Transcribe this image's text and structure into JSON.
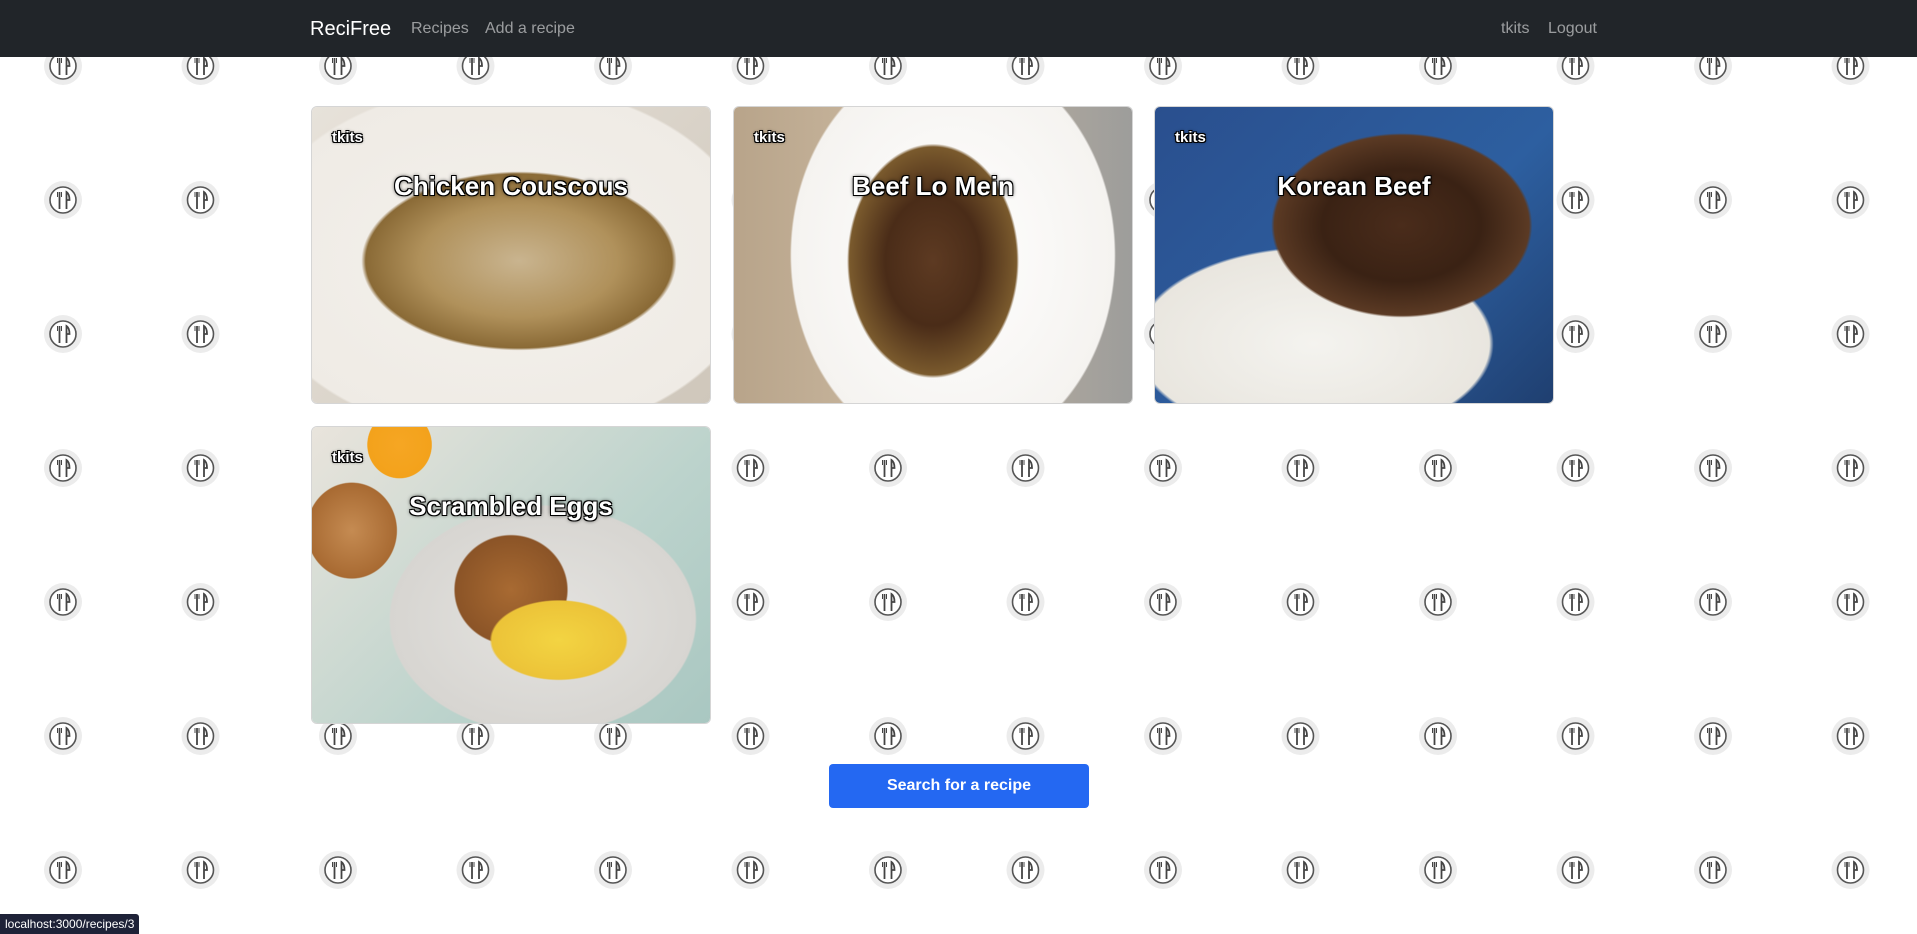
{
  "navbar": {
    "brand": "ReciFree",
    "links": [
      {
        "label": "Recipes"
      },
      {
        "label": "Add a recipe"
      }
    ],
    "user": "tkits",
    "logout": "Logout"
  },
  "recipes": [
    {
      "title": "Chicken Couscous",
      "author": "tkits"
    },
    {
      "title": "Beef Lo Mein",
      "author": "tkits"
    },
    {
      "title": "Korean Beef",
      "author": "tkits"
    },
    {
      "title": "Scrambled Eggs",
      "author": "tkits"
    }
  ],
  "search_button": "Search for a recipe",
  "status_url": "localhost:3000/recipes/3",
  "colors": {
    "navbar_bg": "#212529",
    "primary_button": "#2468f2",
    "page_bg": "#ffffff"
  },
  "icons": {
    "background_pattern": "fork-knife-icon"
  }
}
